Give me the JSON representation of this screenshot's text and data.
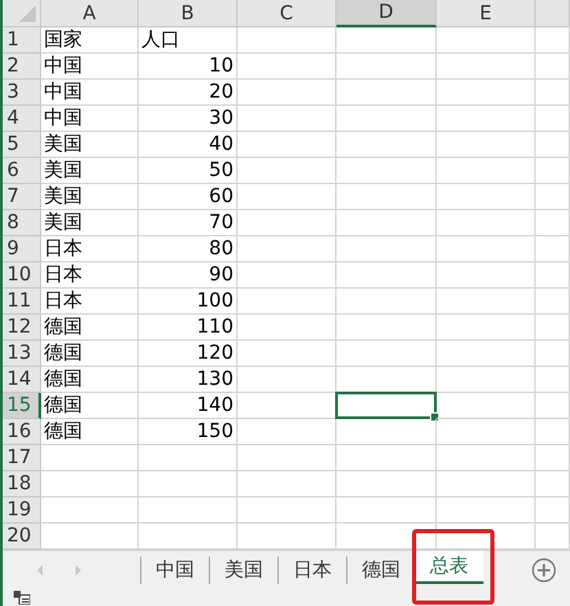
{
  "columns": [
    {
      "label": "A",
      "selected": false
    },
    {
      "label": "B",
      "selected": false
    },
    {
      "label": "C",
      "selected": false
    },
    {
      "label": "D",
      "selected": true
    },
    {
      "label": "E",
      "selected": false
    }
  ],
  "rows": [
    {
      "number": "1",
      "selected": false,
      "cells": [
        {
          "text": "国家",
          "kind": "text"
        },
        {
          "text": "人口",
          "kind": "text"
        }
      ]
    },
    {
      "number": "2",
      "selected": false,
      "cells": [
        {
          "text": "中国",
          "kind": "text"
        },
        {
          "text": "10",
          "kind": "number"
        }
      ]
    },
    {
      "number": "3",
      "selected": false,
      "cells": [
        {
          "text": "中国",
          "kind": "text"
        },
        {
          "text": "20",
          "kind": "number"
        }
      ]
    },
    {
      "number": "4",
      "selected": false,
      "cells": [
        {
          "text": "中国",
          "kind": "text"
        },
        {
          "text": "30",
          "kind": "number"
        }
      ]
    },
    {
      "number": "5",
      "selected": false,
      "cells": [
        {
          "text": "美国",
          "kind": "text"
        },
        {
          "text": "40",
          "kind": "number"
        }
      ]
    },
    {
      "number": "6",
      "selected": false,
      "cells": [
        {
          "text": "美国",
          "kind": "text"
        },
        {
          "text": "50",
          "kind": "number"
        }
      ]
    },
    {
      "number": "7",
      "selected": false,
      "cells": [
        {
          "text": "美国",
          "kind": "text"
        },
        {
          "text": "60",
          "kind": "number"
        }
      ]
    },
    {
      "number": "8",
      "selected": false,
      "cells": [
        {
          "text": "美国",
          "kind": "text"
        },
        {
          "text": "70",
          "kind": "number"
        }
      ]
    },
    {
      "number": "9",
      "selected": false,
      "cells": [
        {
          "text": "日本",
          "kind": "text"
        },
        {
          "text": "80",
          "kind": "number"
        }
      ]
    },
    {
      "number": "10",
      "selected": false,
      "cells": [
        {
          "text": "日本",
          "kind": "text"
        },
        {
          "text": "90",
          "kind": "number"
        }
      ]
    },
    {
      "number": "11",
      "selected": false,
      "cells": [
        {
          "text": "日本",
          "kind": "text"
        },
        {
          "text": "100",
          "kind": "number"
        }
      ]
    },
    {
      "number": "12",
      "selected": false,
      "cells": [
        {
          "text": "德国",
          "kind": "text"
        },
        {
          "text": "110",
          "kind": "number"
        }
      ]
    },
    {
      "number": "13",
      "selected": false,
      "cells": [
        {
          "text": "德国",
          "kind": "text"
        },
        {
          "text": "120",
          "kind": "number"
        }
      ]
    },
    {
      "number": "14",
      "selected": false,
      "cells": [
        {
          "text": "德国",
          "kind": "text"
        },
        {
          "text": "130",
          "kind": "number"
        }
      ]
    },
    {
      "number": "15",
      "selected": true,
      "cells": [
        {
          "text": "德国",
          "kind": "text"
        },
        {
          "text": "140",
          "kind": "number"
        }
      ]
    },
    {
      "number": "16",
      "selected": false,
      "cells": [
        {
          "text": "德国",
          "kind": "text"
        },
        {
          "text": "150",
          "kind": "number"
        }
      ]
    },
    {
      "number": "17",
      "selected": false,
      "cells": []
    },
    {
      "number": "18",
      "selected": false,
      "cells": []
    },
    {
      "number": "19",
      "selected": false,
      "cells": []
    },
    {
      "number": "20",
      "selected": false,
      "cells": []
    }
  ],
  "sheet_tabs": [
    {
      "label": "中国",
      "selected": false,
      "highlighted": false
    },
    {
      "label": "美国",
      "selected": false,
      "highlighted": false
    },
    {
      "label": "日本",
      "selected": false,
      "highlighted": false
    },
    {
      "label": "德国",
      "selected": false,
      "highlighted": false
    },
    {
      "label": "总表",
      "selected": true,
      "highlighted": true
    }
  ]
}
